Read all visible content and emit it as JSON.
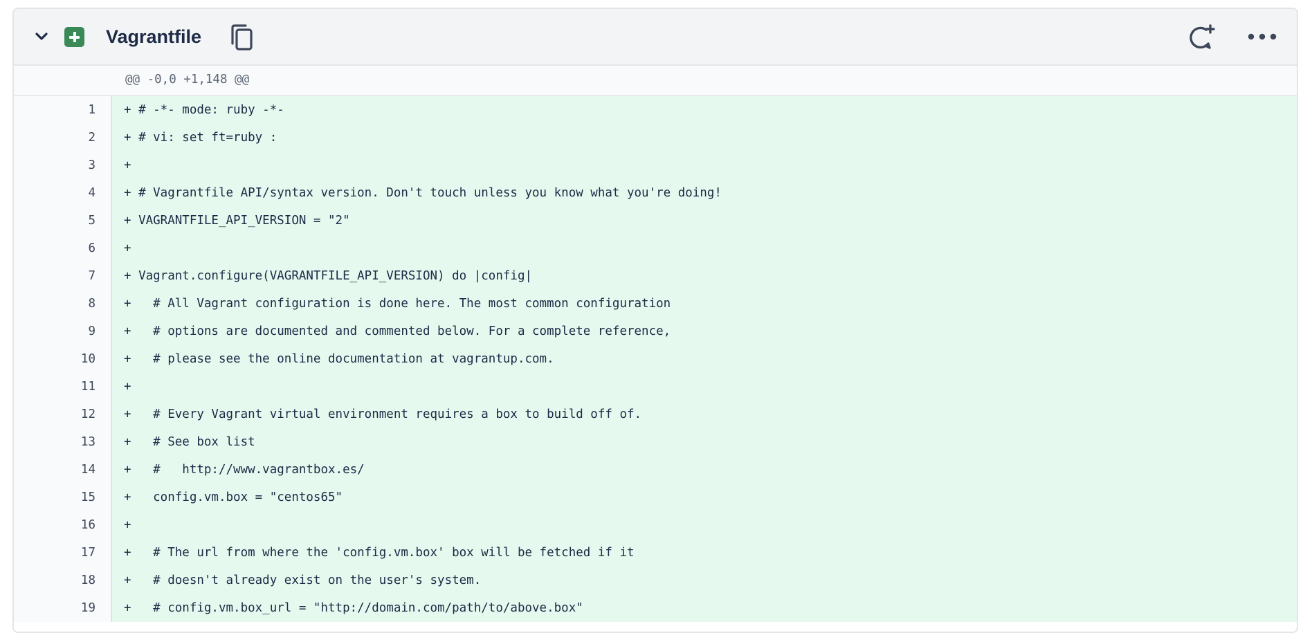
{
  "file": {
    "name": "Vagrantfile",
    "status": "added",
    "icons": [
      "chevron-down-icon",
      "file-added-icon",
      "copy-icon",
      "comment-add-icon",
      "more-icon"
    ]
  },
  "hunk_header": "@@ -0,0 +1,148 @@",
  "colors": {
    "added_bg": "#e6f9ef",
    "badge": "#3a8a58",
    "header_bg": "#f3f4f6",
    "text": "#1d2a45"
  },
  "lines": [
    {
      "num": "1",
      "text": "+ # -*- mode: ruby -*-"
    },
    {
      "num": "2",
      "text": "+ # vi: set ft=ruby :"
    },
    {
      "num": "3",
      "text": "+"
    },
    {
      "num": "4",
      "text": "+ # Vagrantfile API/syntax version. Don't touch unless you know what you're doing!"
    },
    {
      "num": "5",
      "text": "+ VAGRANTFILE_API_VERSION = \"2\""
    },
    {
      "num": "6",
      "text": "+"
    },
    {
      "num": "7",
      "text": "+ Vagrant.configure(VAGRANTFILE_API_VERSION) do |config|"
    },
    {
      "num": "8",
      "text": "+   # All Vagrant configuration is done here. The most common configuration"
    },
    {
      "num": "9",
      "text": "+   # options are documented and commented below. For a complete reference,"
    },
    {
      "num": "10",
      "text": "+   # please see the online documentation at vagrantup.com."
    },
    {
      "num": "11",
      "text": "+"
    },
    {
      "num": "12",
      "text": "+   # Every Vagrant virtual environment requires a box to build off of."
    },
    {
      "num": "13",
      "text": "+   # See box list"
    },
    {
      "num": "14",
      "text": "+   #   http://www.vagrantbox.es/"
    },
    {
      "num": "15",
      "text": "+   config.vm.box = \"centos65\""
    },
    {
      "num": "16",
      "text": "+"
    },
    {
      "num": "17",
      "text": "+   # The url from where the 'config.vm.box' box will be fetched if it"
    },
    {
      "num": "18",
      "text": "+   # doesn't already exist on the user's system."
    },
    {
      "num": "19",
      "text": "+   # config.vm.box_url = \"http://domain.com/path/to/above.box\""
    }
  ]
}
